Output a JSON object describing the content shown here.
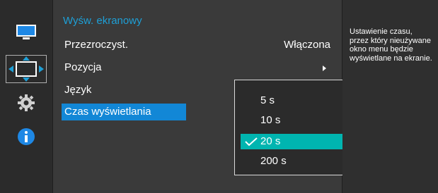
{
  "menu": {
    "title": "Wyśw. ekranowy",
    "items": [
      {
        "label": "Przezroczyst.",
        "value": "Włączona"
      },
      {
        "label": "Pozycja",
        "value": ""
      },
      {
        "label": "Język",
        "value": ""
      },
      {
        "label": "Czas wyświetlania",
        "value": ""
      }
    ]
  },
  "submenu": {
    "options": [
      "5 s",
      "10 s",
      "20 s",
      "200 s"
    ],
    "selected": "20 s"
  },
  "help": {
    "text": "Ustawienie czasu, przez który nieużywane okno menu będzie wyświetlane na ekranie."
  },
  "sidebar": {
    "icons": [
      "monitor-icon",
      "position-icon",
      "gear-icon",
      "info-icon"
    ]
  },
  "colors": {
    "title": "#1e9fd6",
    "selected_row": "#1287d6",
    "selected_option": "#00b5b0",
    "background": "#3a3a3a"
  }
}
